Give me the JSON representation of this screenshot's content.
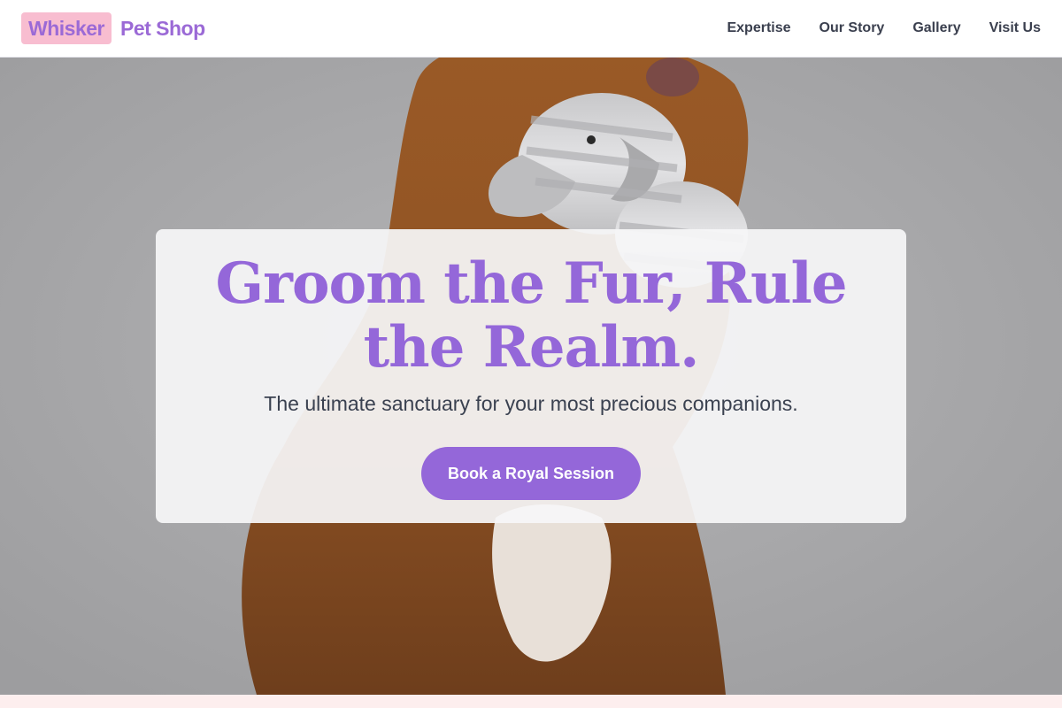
{
  "brand": {
    "badge": "Whisker",
    "rest": "Pet Shop"
  },
  "nav": [
    {
      "label": "Expertise"
    },
    {
      "label": "Our Story"
    },
    {
      "label": "Gallery"
    },
    {
      "label": "Visit Us"
    }
  ],
  "hero": {
    "title": "Groom the Fur, Rule the Realm.",
    "subtitle": "The ultimate sanctuary for your most precious companions.",
    "cta": "Book a Royal Session"
  },
  "colors": {
    "accent": "#9467d9",
    "brand_badge_bg": "#f8bdd0",
    "nav_text": "#3a3f4e",
    "hero_bg": "#a8a8aa"
  },
  "icons": {
    "hero_image": "dog-with-plush-elephant-photo"
  }
}
